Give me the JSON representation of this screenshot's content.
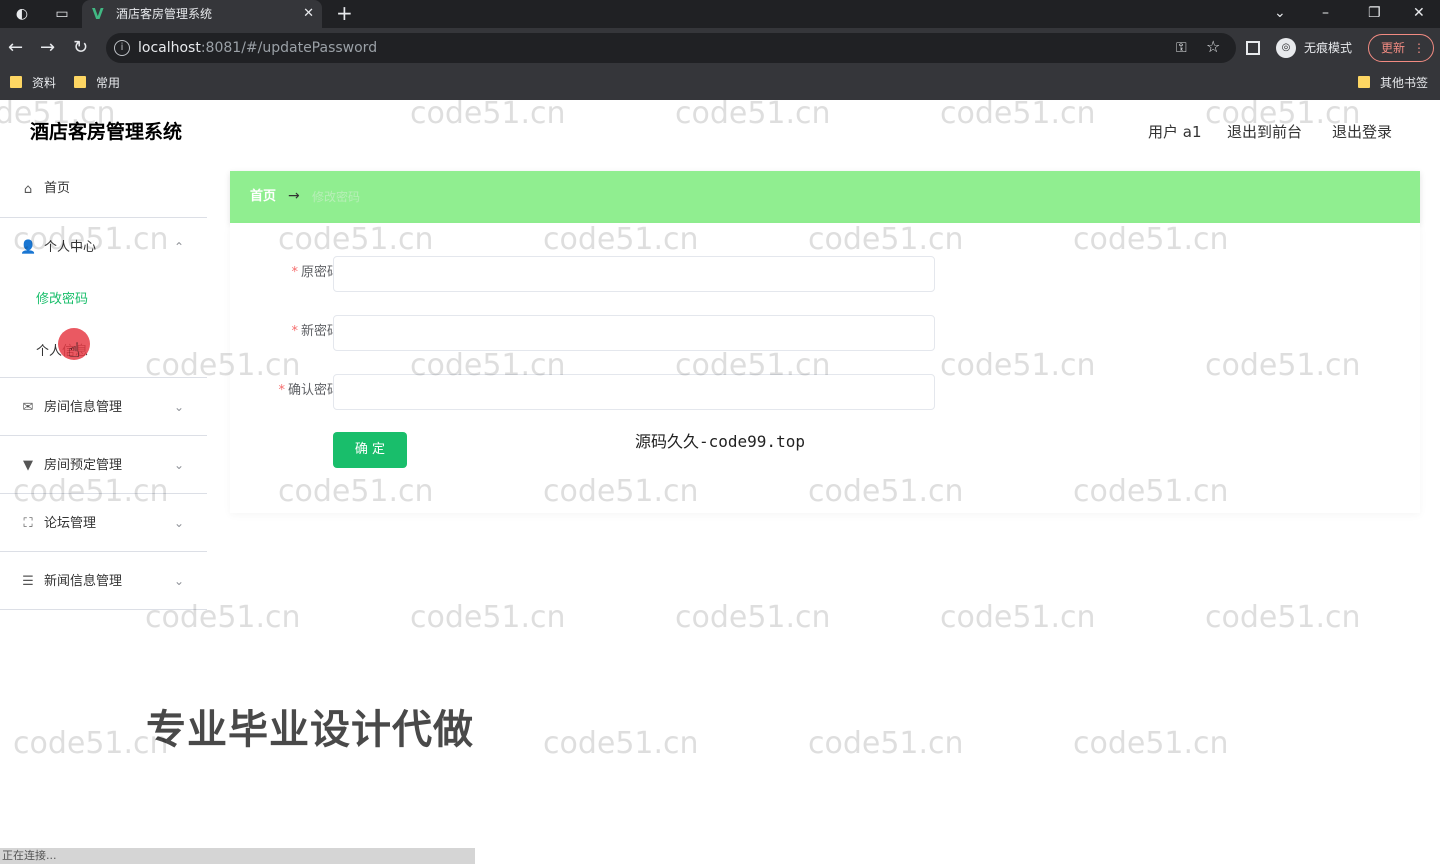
{
  "browser": {
    "tab_title": "酒店客房管理系统",
    "tab_favicon": "V",
    "url_host": "localhost",
    "url_rest": ":8081/#/updatePassword",
    "incognito_label": "无痕模式",
    "update_label": "更新",
    "bookmarks": [
      "资料",
      "常用",
      "其他书签"
    ]
  },
  "header": {
    "brand": "酒店客房管理系统",
    "user_label": "用户 a1",
    "to_frontend": "退出到前台",
    "logout": "退出登录"
  },
  "sidebar": {
    "home": "首页",
    "personal_center": "个人中心",
    "sub_change_password": "修改密码",
    "sub_personal_info": "个人信息",
    "room_info": "房间信息管理",
    "room_booking": "房间预定管理",
    "forum": "论坛管理",
    "news": "新闻信息管理"
  },
  "breadcrumb": {
    "home": "首页",
    "separator": "→",
    "current": "修改密码"
  },
  "form": {
    "old_password_label": "原密码",
    "new_password_label": "新密码",
    "confirm_password_label": "确认密码",
    "required_mark": "*",
    "submit_label": "确 定"
  },
  "overlays": {
    "watermark": "code51.cn",
    "source_text": "源码久久-code99.top",
    "promo_text": "专业毕业设计代做",
    "status_text": "正在连接..."
  },
  "colors": {
    "breadcrumb_bg": "#90ee90",
    "submit_bg": "#19be6b",
    "active_submenu": "#19be6b",
    "required": "#f56c6c"
  },
  "icons": {
    "home": "home-icon",
    "user": "user-icon",
    "room": "mail-icon",
    "booking": "pin-icon",
    "forum": "scan-icon",
    "news": "sliders-icon"
  }
}
